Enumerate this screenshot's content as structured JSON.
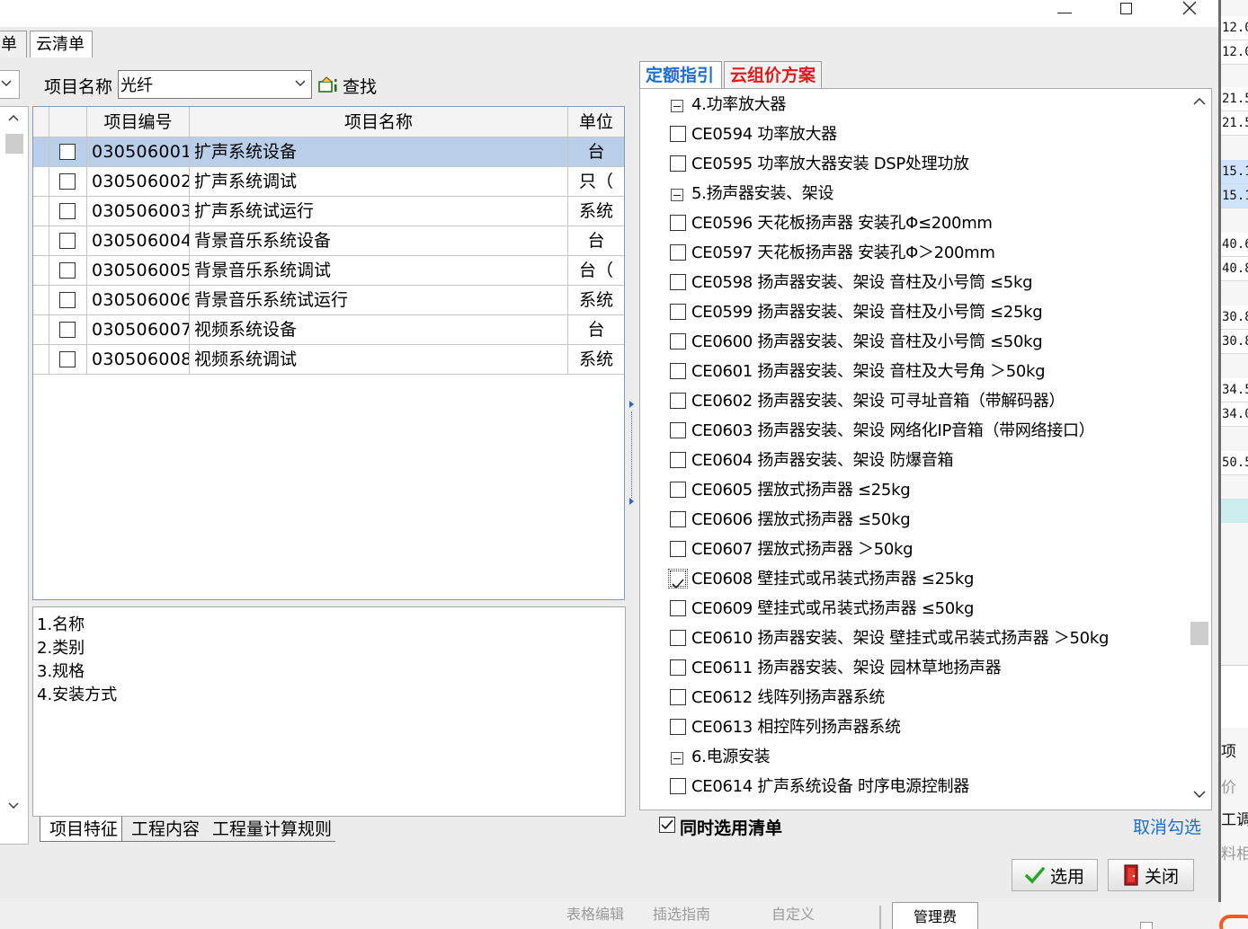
{
  "window": {
    "top_tabs": [
      "单",
      "云清单"
    ]
  },
  "search": {
    "label": "项目名称",
    "value": "光纤",
    "find_label": "查找"
  },
  "table": {
    "headers": [
      "项目编号",
      "项目名称",
      "单位"
    ],
    "rows": [
      {
        "code": "030506001",
        "name": "扩声系统设备",
        "unit": "台",
        "selected": true
      },
      {
        "code": "030506002",
        "name": "扩声系统调试",
        "unit": "只（",
        "selected": false
      },
      {
        "code": "030506003",
        "name": "扩声系统试运行",
        "unit": "系统",
        "selected": false
      },
      {
        "code": "030506004",
        "name": "背景音乐系统设备",
        "unit": "台",
        "selected": false
      },
      {
        "code": "030506005",
        "name": "背景音乐系统调试",
        "unit": "台（",
        "selected": false
      },
      {
        "code": "030506006",
        "name": "背景音乐系统试运行",
        "unit": "系统",
        "selected": false
      },
      {
        "code": "030506007",
        "name": "视频系统设备",
        "unit": "台",
        "selected": false
      },
      {
        "code": "030506008",
        "name": "视频系统调试",
        "unit": "系统",
        "selected": false
      }
    ]
  },
  "features": [
    "1.名称",
    "2.类别",
    "3.规格",
    "4.安装方式"
  ],
  "bottom_tabs": [
    "项目特征",
    "工程内容",
    "工程量计算规则"
  ],
  "right_tabs": {
    "quota": "定额指引",
    "cloud_price": "云组价方案"
  },
  "tree": [
    {
      "type": "group",
      "text": "4.功率放大器"
    },
    {
      "type": "item",
      "text": "CE0594 功率放大器",
      "checked": false
    },
    {
      "type": "item",
      "text": "CE0595 功率放大器安装 DSP处理功放",
      "checked": false
    },
    {
      "type": "group",
      "text": "5.扬声器安装、架设"
    },
    {
      "type": "item",
      "text": "CE0596 天花板扬声器 安装孔Φ≤200mm",
      "checked": false
    },
    {
      "type": "item",
      "text": "CE0597 天花板扬声器 安装孔Φ＞200mm",
      "checked": false
    },
    {
      "type": "item",
      "text": "CE0598 扬声器安装、架设 音柱及小号筒 ≤5kg",
      "checked": false
    },
    {
      "type": "item",
      "text": "CE0599 扬声器安装、架设 音柱及小号筒 ≤25kg",
      "checked": false
    },
    {
      "type": "item",
      "text": "CE0600 扬声器安装、架设 音柱及小号筒 ≤50kg",
      "checked": false
    },
    {
      "type": "item",
      "text": "CE0601 扬声器安装、架设 音柱及大号角 ＞50kg",
      "checked": false
    },
    {
      "type": "item",
      "text": "CE0602 扬声器安装、架设 可寻址音箱（带解码器）",
      "checked": false
    },
    {
      "type": "item",
      "text": "CE0603 扬声器安装、架设 网络化IP音箱（带网络接口）",
      "checked": false
    },
    {
      "type": "item",
      "text": "CE0604 扬声器安装、架设 防爆音箱",
      "checked": false
    },
    {
      "type": "item",
      "text": "CE0605 摆放式扬声器 ≤25kg",
      "checked": false
    },
    {
      "type": "item",
      "text": "CE0606 摆放式扬声器 ≤50kg",
      "checked": false
    },
    {
      "type": "item",
      "text": "CE0607 摆放式扬声器 ＞50kg",
      "checked": false
    },
    {
      "type": "item",
      "text": "CE0608 壁挂式或吊装式扬声器 ≤25kg",
      "checked": true
    },
    {
      "type": "item",
      "text": "CE0609 壁挂式或吊装式扬声器 ≤50kg",
      "checked": false
    },
    {
      "type": "item",
      "text": "CE0610 扬声器安装、架设 壁挂式或吊装式扬声器 ＞50kg",
      "checked": false
    },
    {
      "type": "item",
      "text": "CE0611 扬声器安装、架设 园林草地扬声器",
      "checked": false
    },
    {
      "type": "item",
      "text": "CE0612 线阵列扬声器系统",
      "checked": false
    },
    {
      "type": "item",
      "text": "CE0613 相控阵列扬声器系统",
      "checked": false
    },
    {
      "type": "group",
      "text": "6.电源安装"
    },
    {
      "type": "item",
      "text": "CE0614 扩声系统设备 时序电源控制器",
      "checked": false
    }
  ],
  "also_select": {
    "label": "同时选用清单",
    "checked": true
  },
  "cancel_link": "取消勾选",
  "buttons": {
    "ok": "选用",
    "close": "关闭"
  },
  "background_app": {
    "values": [
      "12.0",
      "12.0",
      "21.5",
      "21.5",
      "15.1",
      "15.1",
      "40.6",
      "40.8",
      "30.8",
      "30.8",
      "34.5",
      "34.0",
      "50.5"
    ],
    "labels": [
      "项",
      "价",
      "工调",
      "料相"
    ],
    "bottom_items": [
      "表格编辑",
      "插选指南",
      "自定义",
      "管理费"
    ]
  },
  "colors": {
    "accent_blue": "#1e6fd0",
    "accent_red": "#e01b1b",
    "selected_row": "#b9cfe9",
    "ok_check": "#2aa52a",
    "close_red": "#c62828"
  }
}
